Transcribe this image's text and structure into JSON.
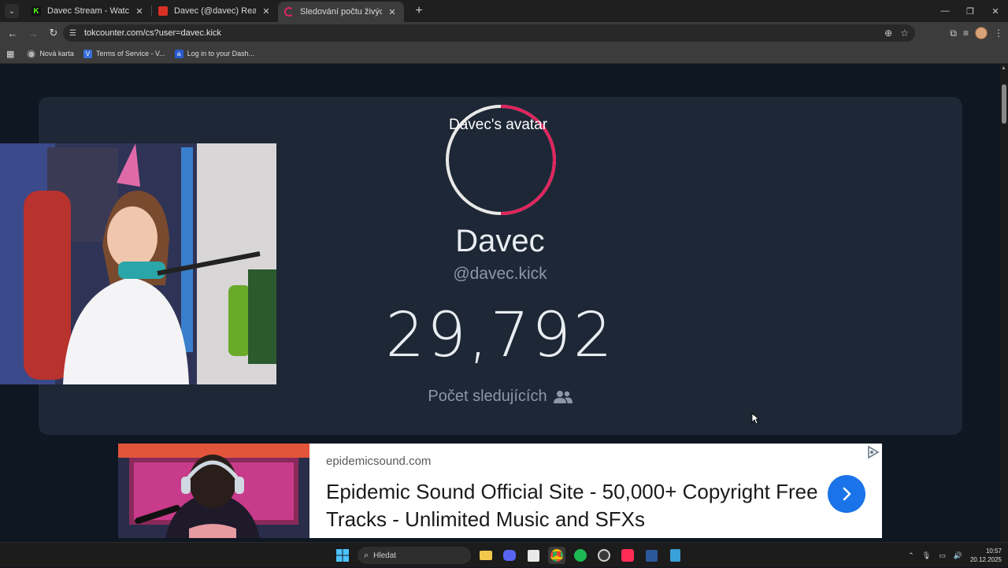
{
  "browser": {
    "tabs": [
      {
        "title": "Davec Stream - Watch Live on K",
        "favicon_color": "#53fc18",
        "active": false
      },
      {
        "title": "Davec (@davec) Realtime Kick Li",
        "favicon_color": "#d93025",
        "active": false
      },
      {
        "title": "Sledování počtu živých fanoušk",
        "favicon_color": "#e0245e",
        "active": true
      }
    ],
    "url": "tokcounter.com/cs?user=davec.kick",
    "bookmarks": [
      {
        "label": "Nová karta",
        "icon": "globe-icon"
      },
      {
        "label": "Terms of Service - V...",
        "icon": "v-icon"
      },
      {
        "label": "Log in to your Dash...",
        "icon": "a-icon"
      }
    ]
  },
  "profile": {
    "avatar_alt": "Davec's avatar",
    "display_name": "Davec",
    "username": "@davec.kick",
    "follower_count": "29,792",
    "follower_label": "Počet sledujících",
    "ring_progress": 0.5
  },
  "ad": {
    "domain": "epidemicsound.com",
    "title": "Epidemic Sound Official Site - 50,000+ Copyright Free Tracks - Unlimited Music and SFXs"
  },
  "taskbar": {
    "search_label": "Hledat",
    "time": "10:57",
    "date": "20.12.2025"
  },
  "colors": {
    "page_bg": "#0f1722",
    "card_bg": "#1d2735",
    "ring_accent": "#e0245e",
    "ad_button": "#1a73e8"
  }
}
